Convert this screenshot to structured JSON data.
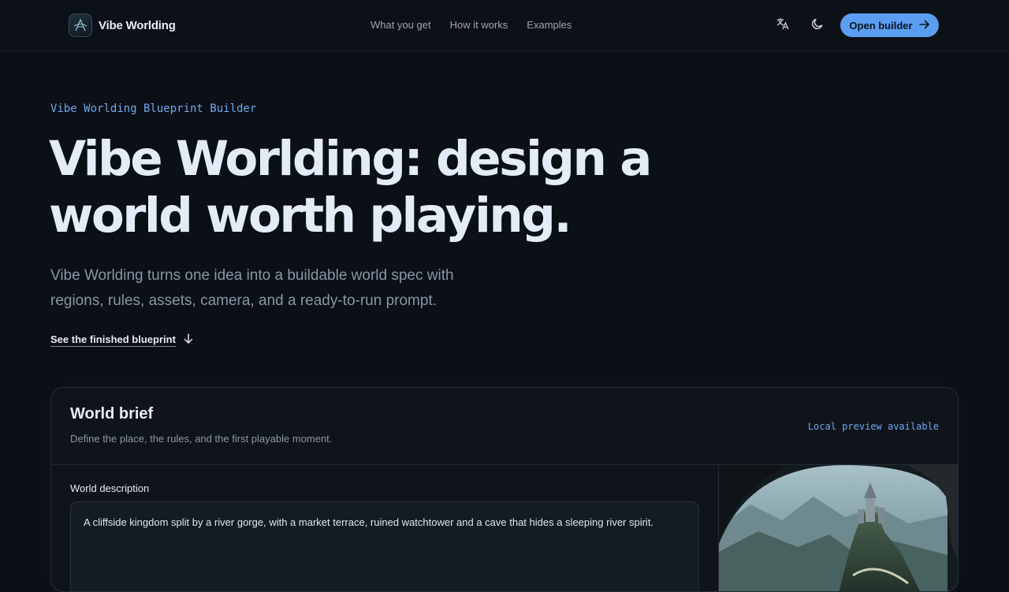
{
  "header": {
    "brand_name": "Vibe Worlding",
    "nav": [
      "What you get",
      "How it works",
      "Examples"
    ],
    "cta_label": "Open builder",
    "icons": [
      "translate-icon",
      "moon-icon",
      "arrow-right-icon"
    ]
  },
  "hero": {
    "eyebrow": "Vibe Worlding Blueprint Builder",
    "title_line1": "Vibe Worlding: design a",
    "title_line2": "world worth playing.",
    "subtitle": "Vibe Worlding turns one idea into a buildable world spec with regions, rules, assets, camera, and a ready-to-run prompt.",
    "link_label": "See the finished blueprint"
  },
  "card": {
    "title": "World brief",
    "description": "Define the place, the rules, and the first playable moment.",
    "status": "Local preview available",
    "field_label": "World description",
    "field_value": "A cliffside kingdom split by a river gorge, with a market terrace, ruined watchtower and a cave that hides a sleeping river spirit."
  },
  "colors": {
    "background": "#0b0f16",
    "accent": "#5b9df0",
    "eyebrow": "#6fa8ec"
  }
}
